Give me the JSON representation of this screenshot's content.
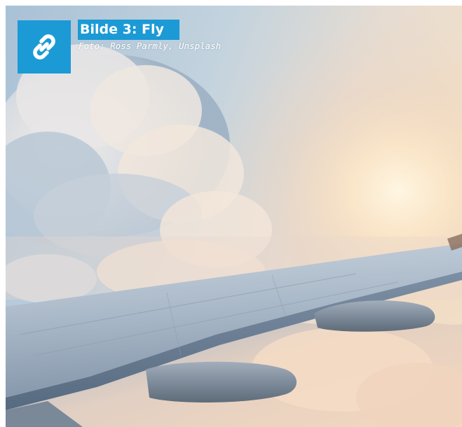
{
  "caption": {
    "title": "Bilde 3: Fly",
    "credit": "Foto: Ross Parmly, Unsplash"
  },
  "badge": {
    "icon": "link-icon",
    "background": "#1b9ad6"
  },
  "photo": {
    "subject": "airplane-wing-above-clouds"
  }
}
